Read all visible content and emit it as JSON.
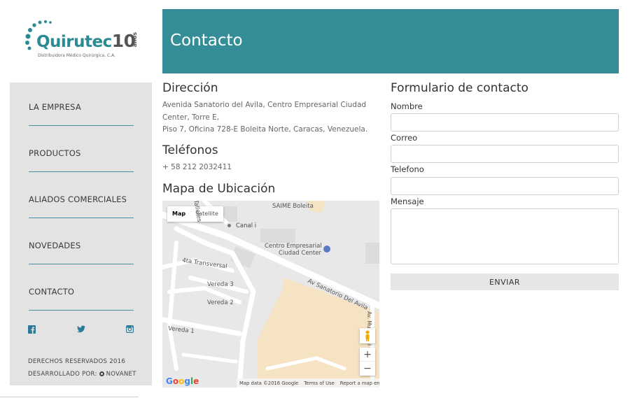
{
  "logo": {
    "name": "Quirutec",
    "years": "10",
    "years_word": "años",
    "subtitle": "Distribuidora Médico Quirúrgica, C.A."
  },
  "header": {
    "title": "Contacto"
  },
  "sidebar": {
    "items": [
      {
        "label": "LA EMPRESA"
      },
      {
        "label": "PRODUCTOS"
      },
      {
        "label": "ALIADOS COMERCIALES"
      },
      {
        "label": "NOVEDADES"
      },
      {
        "label": "CONTACTO"
      }
    ],
    "social": [
      "facebook-icon",
      "twitter-icon",
      "instagram-icon"
    ],
    "copyright": "DERECHOS RESERVADOS 2016",
    "developed_by": "DESARROLLADO POR: ",
    "developer": "NOVANET"
  },
  "address": {
    "title": "Dirección",
    "line1": "Avenida Sanatorio del Avila, Centro Empresarial Ciudad Center, Torre E,",
    "line2": "Piso 7, Oficina 728-E Boleita Norte, Caracas, Venezuela."
  },
  "phones": {
    "title": "Teléfonos",
    "number": "+ 58 212 2032411"
  },
  "map": {
    "title": "Mapa de Ubicación",
    "btn_map": "Map",
    "btn_satellite": "Satellite",
    "labels": {
      "saime": "SAIME Boleita",
      "canal": "Canal i",
      "centro1": "Centro Empresarial",
      "centro2": "Ciudad Center",
      "transversal": "4ta Transversal",
      "vereda3": "Vereda 3",
      "vereda2": "Vereda 2",
      "vereda1": "Vereda 1",
      "avenida": "Av Sanatorio Del Avila",
      "talleres": "Talleres",
      "municipal": "Av. Municipal de Pet..."
    },
    "google": "Google",
    "footer": {
      "data": "Map data ©2016 Google",
      "terms": "Terms of Use",
      "report": "Report a map error"
    },
    "zoom_in": "+",
    "zoom_out": "−"
  },
  "form": {
    "title": "Formulario de contacto",
    "name_label": "Nombre",
    "email_label": "Correo",
    "phone_label": "Telefono",
    "message_label": "Mensaje",
    "name_value": "",
    "email_value": "",
    "phone_value": "",
    "message_value": "",
    "submit": "ENVIAR"
  },
  "colors": {
    "brand": "#358e97",
    "sidebar_bg": "#e3e3e3",
    "map_land": "#f5e3c3"
  }
}
